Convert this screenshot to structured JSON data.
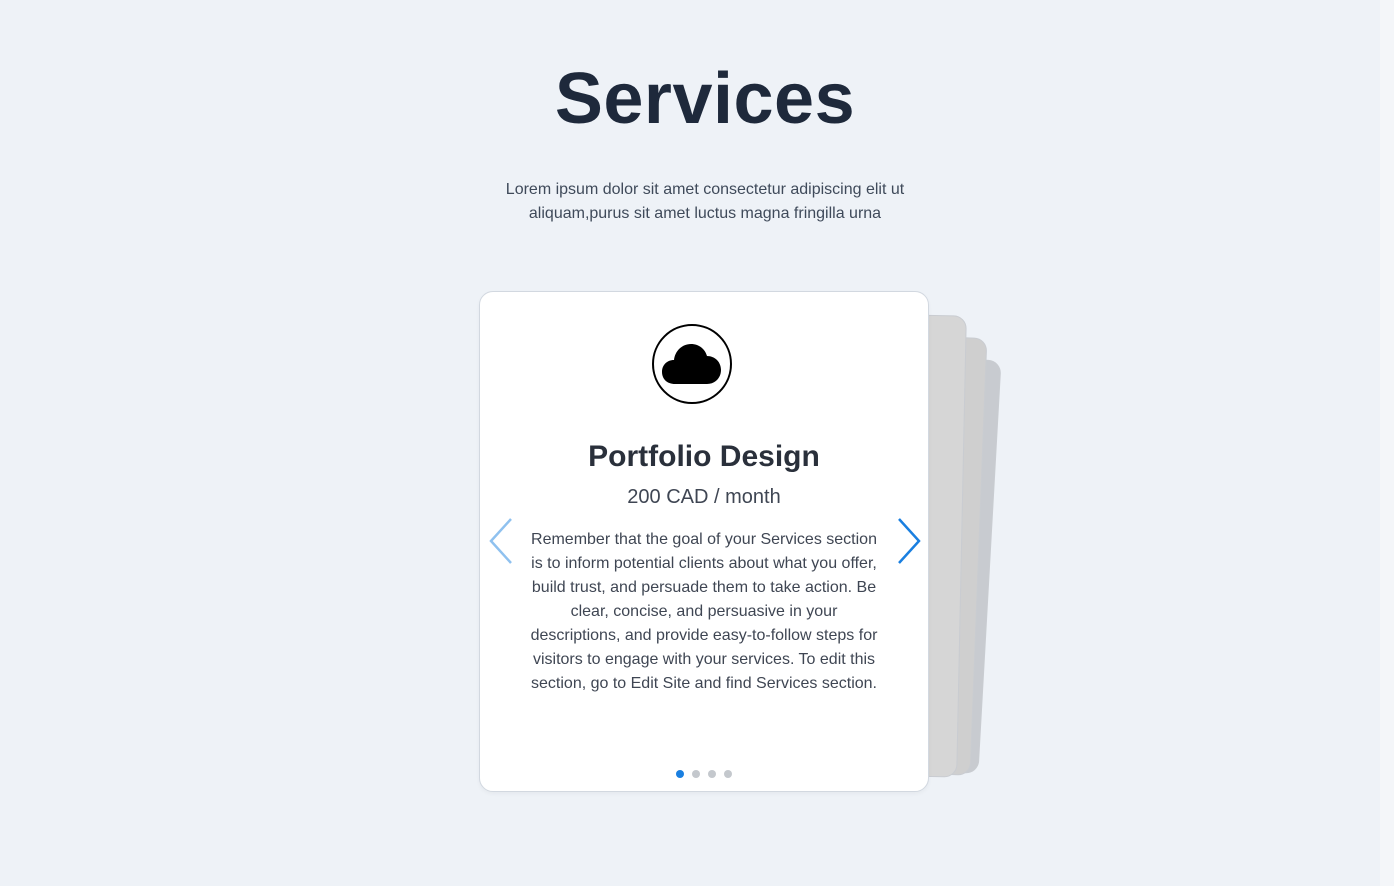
{
  "section": {
    "title": "Services",
    "subtitle": "Lorem ipsum dolor sit amet consectetur adipiscing elit ut aliquam,purus sit amet luctus magna fringilla urna"
  },
  "carousel": {
    "active_index": 0,
    "slide_count": 4,
    "card": {
      "icon": "cloud-icon",
      "title": "Portfolio Design",
      "price": "200 CAD / month",
      "description": "Remember that the goal of your Services section is to inform potential clients about what you offer, build trust, and persuade them to take action. Be clear, concise, and persuasive in your descriptions, and provide easy-to-follow steps for visitors to engage with your services. To edit this section, go to Edit Site and find Services section."
    },
    "prev_icon": "chevron-left-icon",
    "next_icon": "chevron-right-icon"
  },
  "colors": {
    "background": "#eef2f7",
    "heading": "#1e293b",
    "accent": "#1a7fe0",
    "accent_light": "#8fc1ef",
    "dot_inactive": "#c4c8cd"
  }
}
